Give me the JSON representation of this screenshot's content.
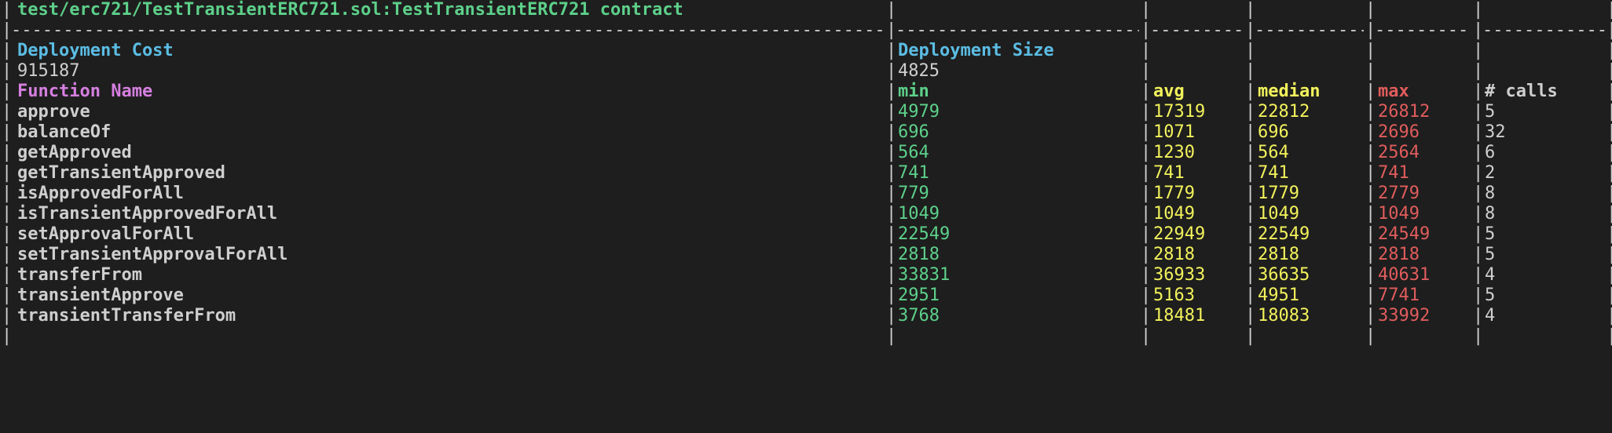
{
  "terminal": {
    "background_color": "#1e1e1e",
    "border_char": "|",
    "separator_char": "-",
    "colors": {
      "green": "#5dd08a",
      "cyan": "#5bbde4",
      "magenta": "#d67fe0",
      "yellow": "#f2f25c",
      "red": "#e05c5c",
      "white": "#cfcfcf"
    }
  },
  "report": {
    "contract_title": "test/erc721/TestTransientERC721.sol:TestTransientERC721 contract",
    "deployment": {
      "cost_label": "Deployment Cost",
      "cost_value": "915187",
      "size_label": "Deployment Size",
      "size_value": "4825"
    },
    "columns": {
      "function_name": "Function Name",
      "min": "min",
      "avg": "avg",
      "median": "median",
      "max": "max",
      "calls": "# calls"
    },
    "rows": [
      {
        "name": "approve",
        "min": "4979",
        "avg": "17319",
        "median": "22812",
        "max": "26812",
        "calls": "5"
      },
      {
        "name": "balanceOf",
        "min": "696",
        "avg": "1071",
        "median": "696",
        "max": "2696",
        "calls": "32"
      },
      {
        "name": "getApproved",
        "min": "564",
        "avg": "1230",
        "median": "564",
        "max": "2564",
        "calls": "6"
      },
      {
        "name": "getTransientApproved",
        "min": "741",
        "avg": "741",
        "median": "741",
        "max": "741",
        "calls": "2"
      },
      {
        "name": "isApprovedForAll",
        "min": "779",
        "avg": "1779",
        "median": "1779",
        "max": "2779",
        "calls": "8"
      },
      {
        "name": "isTransientApprovedForAll",
        "min": "1049",
        "avg": "1049",
        "median": "1049",
        "max": "1049",
        "calls": "8"
      },
      {
        "name": "setApprovalForAll",
        "min": "22549",
        "avg": "22949",
        "median": "22549",
        "max": "24549",
        "calls": "5"
      },
      {
        "name": "setTransientApprovalForAll",
        "min": "2818",
        "avg": "2818",
        "median": "2818",
        "max": "2818",
        "calls": "5"
      },
      {
        "name": "transferFrom",
        "min": "33831",
        "avg": "36933",
        "median": "36635",
        "max": "40631",
        "calls": "4"
      },
      {
        "name": "transientApprove",
        "min": "2951",
        "avg": "5163",
        "median": "4951",
        "max": "7741",
        "calls": "5"
      },
      {
        "name": "transientTransferFrom",
        "min": "3768",
        "avg": "18481",
        "median": "18083",
        "max": "33992",
        "calls": "4"
      }
    ]
  }
}
